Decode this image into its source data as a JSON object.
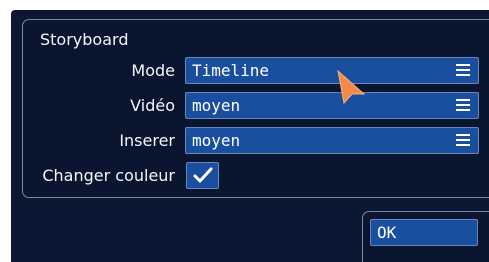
{
  "panel": {
    "title": "Storyboard"
  },
  "fields": {
    "mode": {
      "label": "Mode",
      "value": "Timeline"
    },
    "video": {
      "label": "Vidéo",
      "value": "moyen"
    },
    "inserer": {
      "label": "Inserer",
      "value": "moyen"
    },
    "changer_couleur": {
      "label": "Changer couleur",
      "checked": true
    }
  },
  "actions": {
    "ok_label": "OK"
  },
  "icons": {
    "dropdown": "menu-lines-icon",
    "check": "checkmark-icon",
    "cursor": "arrow-cursor-icon"
  },
  "colors": {
    "background": "#0c1733",
    "control": "#1a4f9f",
    "border": "#7c869f",
    "text": "#ffffff",
    "cursor": "#f28a4b"
  }
}
